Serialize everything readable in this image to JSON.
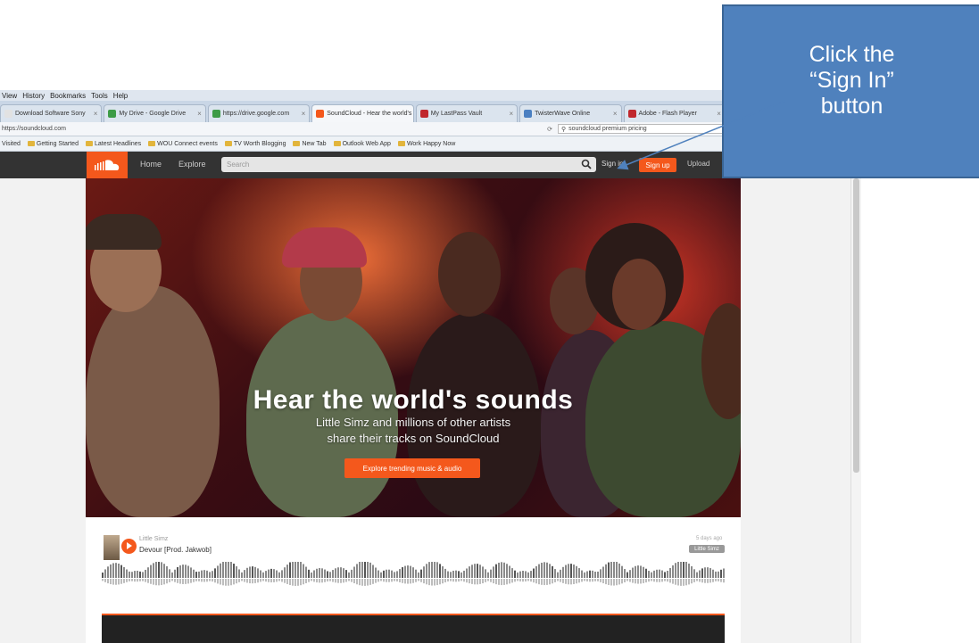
{
  "browser": {
    "menu_items": [
      "View",
      "History",
      "Bookmarks",
      "Tools",
      "Help"
    ],
    "tabs": [
      {
        "label": "Download Software Sony",
        "active": false,
        "favicon_color": "#e2e2e2"
      },
      {
        "label": "My Drive - Google Drive",
        "active": false,
        "favicon_color": "#3d9b46"
      },
      {
        "label": "https://drive.google.com",
        "active": false,
        "favicon_color": "#3d9b46"
      },
      {
        "label": "SoundCloud - Hear the world's",
        "active": true,
        "favicon_color": "#f4581c"
      },
      {
        "label": "My LastPass Vault",
        "active": false,
        "favicon_color": "#c0272d"
      },
      {
        "label": "TwisterWave Online",
        "active": false,
        "favicon_color": "#4a7fc1"
      },
      {
        "label": "Adobe - Flash Player",
        "active": false,
        "favicon_color": "#c0272d"
      }
    ],
    "url": "https://soundcloud.com",
    "search_value": "soundcloud premium pricing",
    "bookmarks": [
      "Getting Started",
      "Latest Headlines",
      "WOU Connect events",
      "TV Worth Blogging",
      "New Tab",
      "Outlook Web App",
      "Work Happy Now"
    ],
    "bookmarks_prefix": "Visited"
  },
  "soundcloud": {
    "nav": {
      "home": "Home",
      "explore": "Explore"
    },
    "search_placeholder": "Search",
    "sign_in": "Sign in",
    "sign_up": "Sign up",
    "upload": "Upload",
    "hero": {
      "title": "Hear the world's sounds",
      "subtitle_line1": "Little Simz and millions of other artists",
      "subtitle_line2": "share their tracks on SoundCloud",
      "cta": "Explore trending music & audio"
    },
    "track": {
      "user": "Little Simz",
      "title": "Devour [Prod. Jakwob]",
      "age": "5 days ago",
      "tag": "Little Simz"
    }
  },
  "callout": {
    "line1": "Click the",
    "line2": "“Sign In”",
    "line3": "button"
  },
  "colors": {
    "brand": "#f4581c",
    "header": "#333333",
    "callout": "#4f81bd"
  }
}
